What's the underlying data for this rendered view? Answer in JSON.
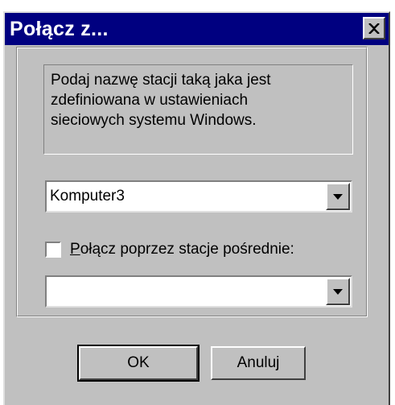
{
  "window": {
    "title": "Połącz z..."
  },
  "icons": {
    "close": "close-x-icon",
    "dropdown": "triangle-down-icon"
  },
  "description": {
    "line1": "Podaj nazwę stacji taką jaka jest",
    "line2": "zdefiniowana w ustawieniach",
    "line3": "sieciowych systemu Windows."
  },
  "station_combo": {
    "value": "Komputer3"
  },
  "via_checkbox": {
    "mnemonic": "P",
    "label_rest": "ołącz poprzez stacje pośrednie:",
    "checked": false
  },
  "intermediate_combo": {
    "value": ""
  },
  "buttons": {
    "ok": "OK",
    "cancel": "Anuluj"
  },
  "colors": {
    "titlebar": "#000080",
    "face": "#c0c0c0",
    "field": "#ffffff"
  }
}
